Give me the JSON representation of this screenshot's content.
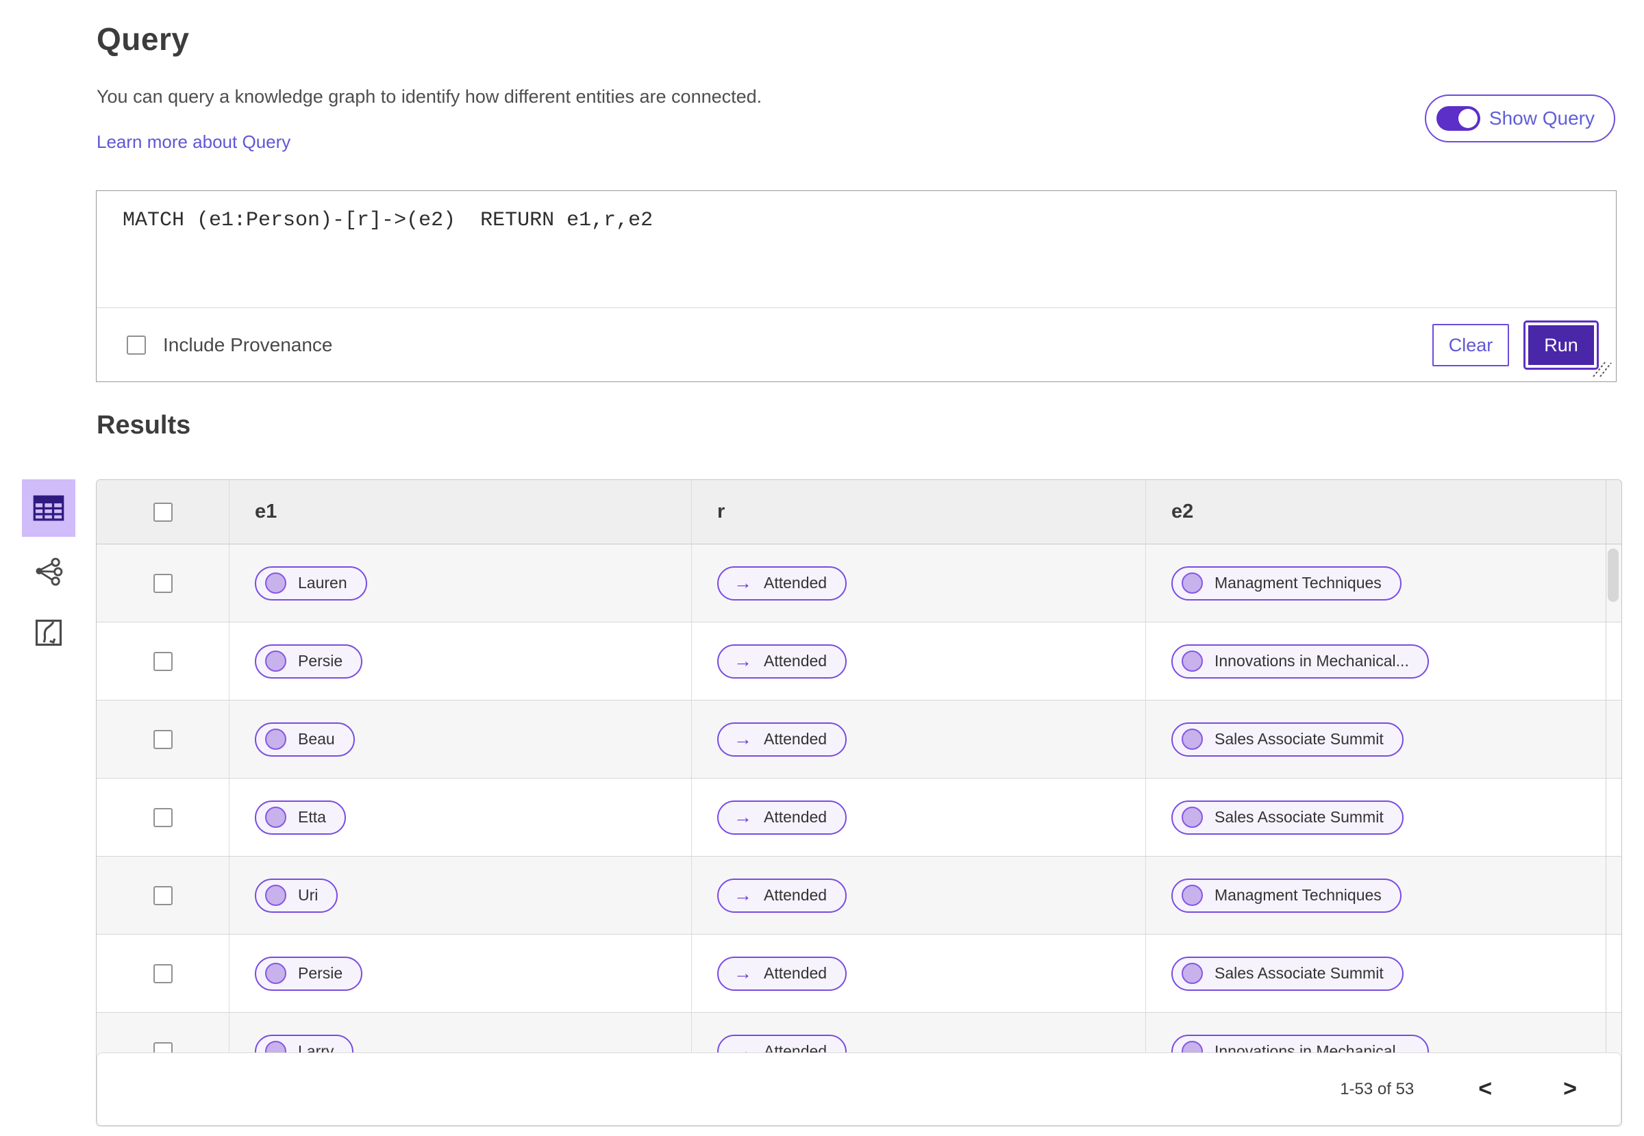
{
  "query_section": {
    "title": "Query",
    "description": "You can query a knowledge graph to identify how different entities are connected.",
    "learn_more_link": "Learn more about Query",
    "show_query_toggle": {
      "label": "Show Query",
      "state": "on"
    },
    "editor": {
      "code": "MATCH (e1:Person)-[r]->(e2)  RETURN e1,r,e2",
      "include_provenance_label": "Include Provenance",
      "include_provenance_checked": false,
      "clear_button": "Clear",
      "run_button": "Run"
    }
  },
  "results_section": {
    "title": "Results",
    "view_switcher": {
      "items": [
        {
          "icon": "table-view-icon",
          "selected": true
        },
        {
          "icon": "network-view-icon",
          "selected": false
        },
        {
          "icon": "chart-view-icon",
          "selected": false
        }
      ]
    },
    "table": {
      "columns": [
        "e1",
        "r",
        "e2"
      ],
      "relation_arrow": "→",
      "rows": [
        {
          "e1": "Lauren",
          "r": "Attended",
          "e2": "Managment Techniques"
        },
        {
          "e1": "Persie",
          "r": "Attended",
          "e2": "Innovations in Mechanical..."
        },
        {
          "e1": "Beau",
          "r": "Attended",
          "e2": "Sales Associate Summit"
        },
        {
          "e1": "Etta",
          "r": "Attended",
          "e2": "Sales Associate Summit"
        },
        {
          "e1": "Uri",
          "r": "Attended",
          "e2": "Managment Techniques"
        },
        {
          "e1": "Persie",
          "r": "Attended",
          "e2": "Sales Associate Summit"
        },
        {
          "e1": "Larry",
          "r": "Attended",
          "e2": "Innovations in Mechanical..."
        }
      ]
    },
    "pagination": {
      "range": "1-53 of 53",
      "prev": "<",
      "next": ">"
    }
  },
  "colors": {
    "accent_purple": "#6e4bdb",
    "run_button_fill": "#4a26a8",
    "selected_view_bg": "#cfbcf9",
    "link_purple": "#5f57d6",
    "pill_background": "#f6f3fc",
    "pill_circle_fill": "#c7b2ec",
    "table_header_bg": "#efefef",
    "alt_row_bg": "#f6f6f6"
  }
}
